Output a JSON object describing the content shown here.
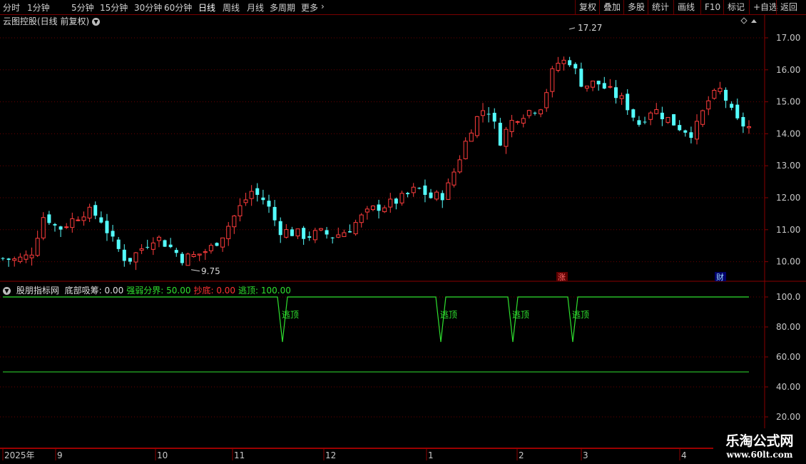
{
  "toolbar": {
    "periods": [
      "分时",
      "1分钟",
      "5分钟",
      "15分钟",
      "30分钟",
      "60分钟",
      "日线",
      "周线",
      "月线",
      "多周期",
      "更多"
    ],
    "active_period": "日线",
    "more_icon": "chevron-right-icon",
    "right_buttons": [
      "复权",
      "叠加",
      "多股",
      "统计",
      "画线",
      "F10",
      "标记",
      "+自选",
      "返回"
    ]
  },
  "main_chart": {
    "title": "云图控股(日线 前复权)",
    "title_icon": "chevron-down-icon",
    "y_ticks": [
      "17.00",
      "16.00",
      "15.00",
      "14.00",
      "13.00",
      "12.00",
      "11.00",
      "10.00"
    ],
    "y_tick_values": [
      17,
      16,
      15,
      14,
      13,
      12,
      11,
      10
    ],
    "high_label": "17.27",
    "low_label": "9.75",
    "badge_zhang": "涨",
    "badge_cai": "财",
    "colors": {
      "up": "#ff3c3c",
      "down": "#54ffff",
      "grid": "#6a0000"
    }
  },
  "indicator": {
    "source": "股朋指标网",
    "items": [
      {
        "label": "底部吸筹: 0.00",
        "color": "#e0e0e0"
      },
      {
        "label": "强弱分界: 50.00",
        "color": "#2fe02f"
      },
      {
        "label": "抄底: 0.00",
        "color": "#ff3333"
      },
      {
        "label": "逃顶: 100.00",
        "color": "#2fe02f"
      }
    ],
    "y_ticks": [
      "100.0",
      "80.00",
      "60.00",
      "40.00",
      "20.00"
    ],
    "y_tick_values": [
      100,
      80,
      60,
      40,
      20
    ],
    "signal_label": "逃顶",
    "signal_count": 4,
    "boundary_value": 50,
    "base_value": 100,
    "dip_value": 70
  },
  "time_axis": {
    "labels": [
      "2025年",
      "9",
      "10",
      "11",
      "12",
      "1",
      "2",
      "3",
      "4"
    ]
  },
  "logo": {
    "line1": "乐淘公式网",
    "line2": "www.60lt.com"
  },
  "chart_data": {
    "type": "candlestick",
    "title": "云图控股(日线 前复权)",
    "ylim": [
      9.6,
      17.6
    ],
    "y_ticks": [
      10,
      11,
      12,
      13,
      14,
      15,
      16,
      17
    ],
    "x_labels": [
      "2025年",
      "9",
      "10",
      "11",
      "12",
      "1",
      "2",
      "3",
      "4"
    ],
    "high_point": 17.27,
    "low_point": 9.75,
    "close_path_approx": [
      10.1,
      10.05,
      10.2,
      11.5,
      11.0,
      11.3,
      11.6,
      11.4,
      10.6,
      10.0,
      10.4,
      10.8,
      10.5,
      10.1,
      10.2,
      10.4,
      10.9,
      11.6,
      12.2,
      11.9,
      11.0,
      10.9,
      10.8,
      10.9,
      10.8,
      11.0,
      11.4,
      11.7,
      11.8,
      12.0,
      12.3,
      12.0,
      12.1,
      13.2,
      14.3,
      14.9,
      13.8,
      14.5,
      14.7,
      14.9,
      16.2,
      16.3,
      15.5,
      15.6,
      15.3,
      15.0,
      14.3,
      14.8,
      14.5,
      14.2,
      14.0,
      15.0,
      15.4,
      14.4,
      14.2
    ]
  }
}
